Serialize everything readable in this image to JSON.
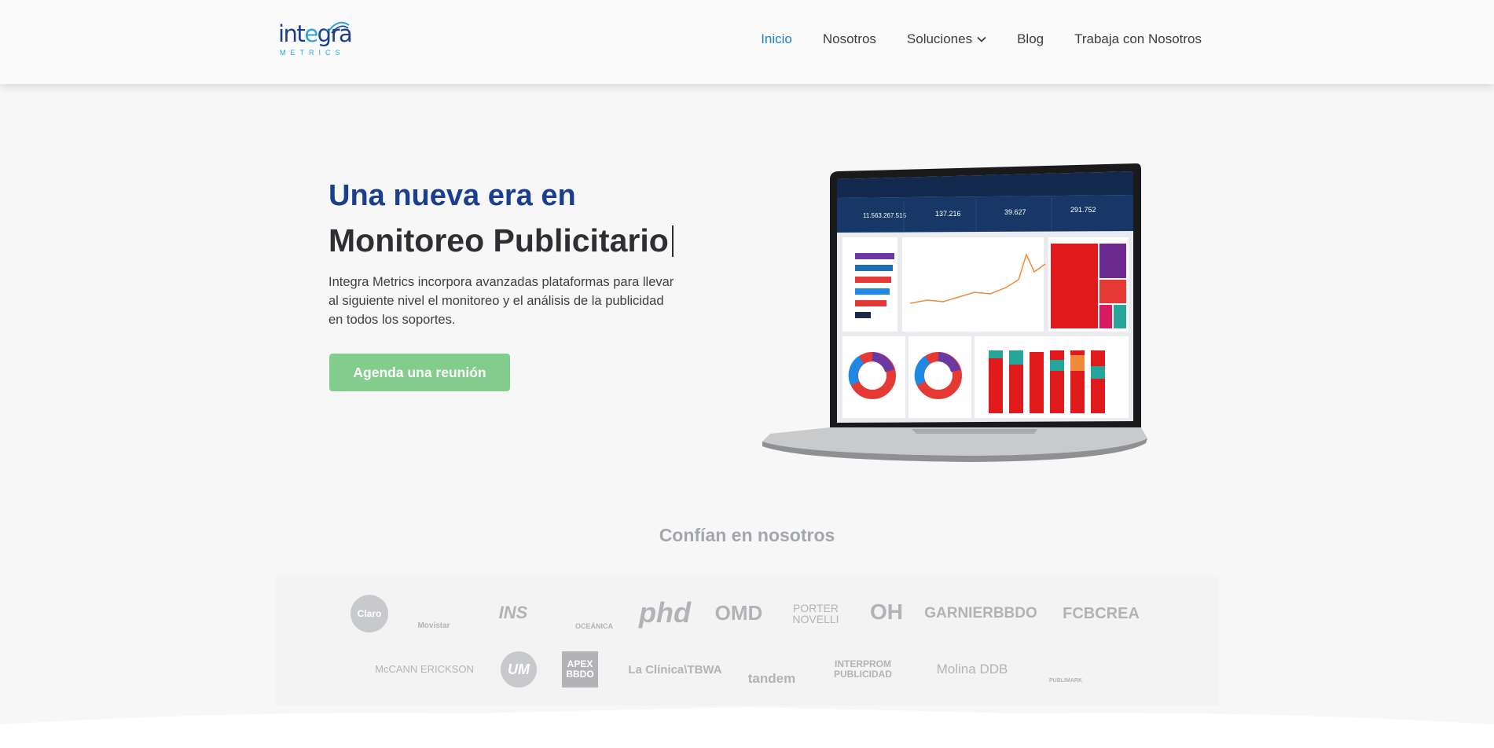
{
  "header": {
    "logo": {
      "word_a": "int",
      "word_b": "e",
      "word_c": "gra",
      "sub": "METRICS"
    },
    "nav": [
      {
        "label": "Inicio",
        "active": true
      },
      {
        "label": "Nosotros"
      },
      {
        "label": "Soluciones"
      },
      {
        "label": "Blog"
      },
      {
        "label": "Trabaja con Nosotros"
      }
    ]
  },
  "hero": {
    "title_line1": "Una nueva era en",
    "title_line2": "Monitoreo Publicitario",
    "description": "Integra Metrics incorpora avanzadas plataformas para llevar al siguiente nivel el monitoreo y el análisis de la publicidad en todos los soportes.",
    "cta_label": "Agenda una reunión"
  },
  "dashboard": {
    "kpi1": "11.563.267.515",
    "kpi2": "137.216",
    "kpi3": "39.627",
    "kpi4": "291.752"
  },
  "clients": {
    "title": "Confían en nosotros",
    "row1": [
      "Claro",
      "Movistar",
      "INS",
      "OCEÁNICA",
      "phd",
      "OMD",
      "PORTER NOVELLI",
      "OH",
      "GARNIERBBDO",
      "FCBCREA"
    ],
    "row2": [
      "McCANN ERICKSON",
      "UM",
      "APEX BBDO",
      "La Clínica\\TBWA",
      "tandem",
      "INTERPROM PUBLICIDAD",
      "Molina DDB",
      "PUBLIMARK"
    ]
  },
  "colors": {
    "brand_blue": "#1b3f8f",
    "accent_blue": "#1f7fd1",
    "cta_green": "#82cd8c",
    "logo_cyan": "#2aa4dc"
  }
}
